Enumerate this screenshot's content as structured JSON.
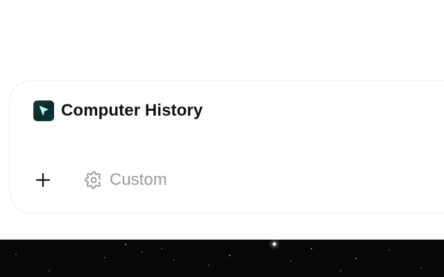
{
  "app": {
    "title": "Computer History"
  },
  "actions": {
    "add_icon": "plus-icon",
    "custom_label": "Custom",
    "custom_icon": "gear-icon"
  },
  "colors": {
    "accent": "#0f3b3a",
    "muted_text": "#9a9a9a",
    "title_text": "#111111",
    "border": "#ececec",
    "starfield_bg": "#050607"
  }
}
